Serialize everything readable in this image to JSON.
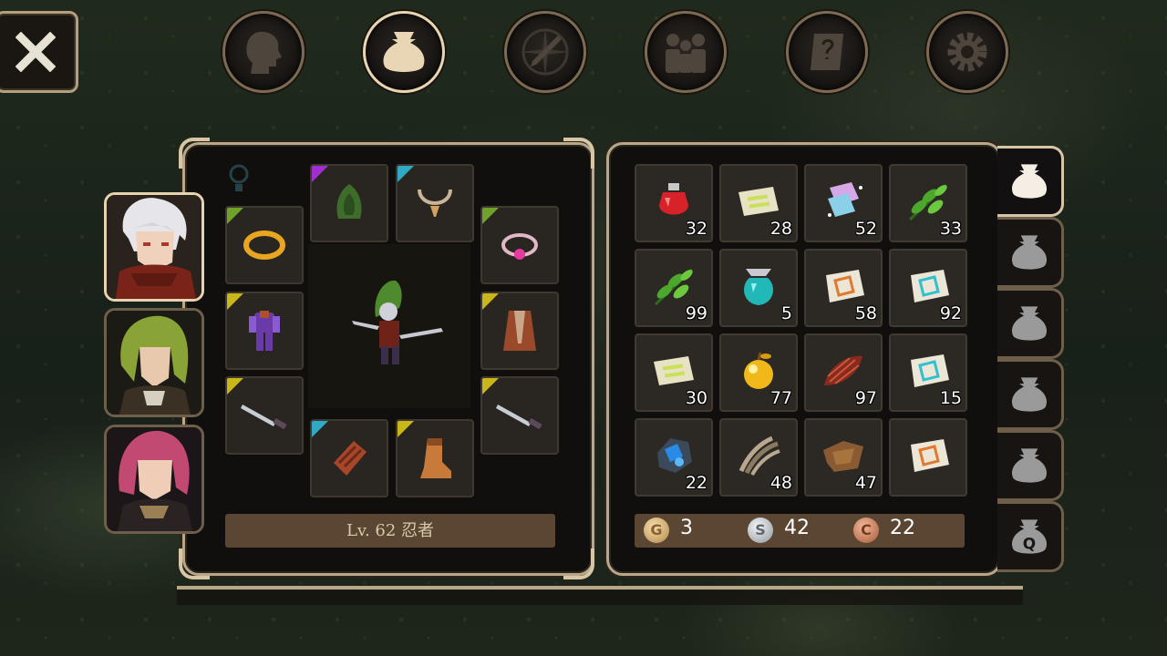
{
  "colors": {
    "frame": "#b9a789",
    "bar": "#5a4632",
    "gold": "#e1c08a",
    "silver": "#cfd3d6",
    "copper": "#d88f6a"
  },
  "top_tabs": [
    {
      "id": "character",
      "icon": "head-icon"
    },
    {
      "id": "inventory",
      "icon": "bag-icon",
      "active": true
    },
    {
      "id": "skills",
      "icon": "compass-sword-icon"
    },
    {
      "id": "party",
      "icon": "group-icon"
    },
    {
      "id": "quests",
      "icon": "scroll-question-icon"
    },
    {
      "id": "settings",
      "icon": "gear-icon"
    }
  ],
  "character": {
    "level_label": "Lv. 62 忍者"
  },
  "portraits": [
    {
      "name": "white-haired-hero",
      "active": true
    },
    {
      "name": "green-haired-ally"
    },
    {
      "name": "pink-haired-ally"
    }
  ],
  "equipment_slots": [
    {
      "slot": "ring-left",
      "icon": "gold-ring-icon",
      "rarity": "#6fa22a"
    },
    {
      "slot": "head",
      "icon": "green-hood-icon",
      "rarity": "#a12fd0"
    },
    {
      "slot": "neck",
      "icon": "bead-necklace-icon",
      "rarity": "#2fa9c4"
    },
    {
      "slot": "ring-right",
      "icon": "pink-gem-ring-icon",
      "rarity": "#6fa22a"
    },
    {
      "slot": "body",
      "icon": "purple-armor-icon",
      "rarity": "#c9b61a"
    },
    {
      "slot": "cloak",
      "icon": "brown-cloak-icon",
      "rarity": "#c9b61a"
    },
    {
      "slot": "main-hand",
      "icon": "dagger-icon",
      "rarity": "#c9b61a"
    },
    {
      "slot": "off-hand",
      "icon": "dagger-icon",
      "rarity": "#c9b61a"
    },
    {
      "slot": "hands",
      "icon": "leather-gauntlet-icon",
      "rarity": "#2fa9c4"
    },
    {
      "slot": "feet",
      "icon": "leather-boot-icon",
      "rarity": "#c9b61a"
    }
  ],
  "inventory": {
    "items": [
      {
        "icon": "red-potion-icon",
        "qty": "32"
      },
      {
        "icon": "green-scroll-icon",
        "qty": "28"
      },
      {
        "icon": "pink-crystal-icon",
        "qty": "52"
      },
      {
        "icon": "green-herb-icon",
        "qty": "33"
      },
      {
        "icon": "green-herb-icon",
        "qty": "99"
      },
      {
        "icon": "cyan-elixir-icon",
        "qty": "5"
      },
      {
        "icon": "orange-map-scroll-icon",
        "qty": "58"
      },
      {
        "icon": "cyan-map-scroll-icon",
        "qty": "92"
      },
      {
        "icon": "green-scroll-icon",
        "qty": "30"
      },
      {
        "icon": "golden-apple-icon",
        "qty": "77"
      },
      {
        "icon": "red-feather-bundle-icon",
        "qty": "97"
      },
      {
        "icon": "cyan-map-scroll-icon",
        "qty": "15"
      },
      {
        "icon": "blue-ore-icon",
        "qty": "22"
      },
      {
        "icon": "claw-icon",
        "qty": "48"
      },
      {
        "icon": "leather-hide-icon",
        "qty": "47"
      },
      {
        "icon": "orange-map-scroll-icon",
        "qty": ""
      }
    ],
    "currency": {
      "gold": {
        "symbol": "G",
        "value": "3"
      },
      "silver": {
        "symbol": "S",
        "value": "42"
      },
      "copper": {
        "symbol": "C",
        "value": "22"
      }
    }
  },
  "bag_tabs": [
    {
      "icon": "bag-icon",
      "active": true
    },
    {
      "icon": "bag-icon"
    },
    {
      "icon": "bag-icon"
    },
    {
      "icon": "bag-icon"
    },
    {
      "icon": "bag-icon"
    },
    {
      "icon": "quest-bag-icon",
      "label": "Q"
    }
  ]
}
